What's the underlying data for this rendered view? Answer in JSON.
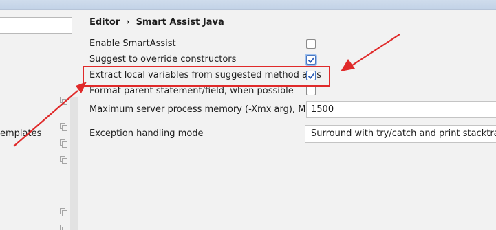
{
  "breadcrumb": {
    "parent": "Editor",
    "separator": "›",
    "current": "Smart Assist Java"
  },
  "left_panel": {
    "partial_item_label": "emplates"
  },
  "settings": {
    "enable_smartassist": {
      "label": "Enable SmartAssist",
      "checked": false
    },
    "suggest_override": {
      "label": "Suggest to override constructors",
      "checked": true
    },
    "extract_local_vars": {
      "label": "Extract local variables from suggested method args",
      "checked": true
    },
    "format_parent": {
      "label": "Format parent statement/field, when possible",
      "checked": false
    },
    "max_memory": {
      "label": "Maximum server process memory (-Xmx arg), MB",
      "value": "1500"
    },
    "exception_mode": {
      "label": "Exception handling mode",
      "selected": "Surround with try/catch and print stacktrace"
    }
  },
  "colors": {
    "annotation_red": "#e02a2a",
    "check_blue": "#2f5fb8",
    "focus_ring": "#9ec0ee"
  },
  "icons": {
    "left_panel_item_icon": "copy-icon"
  }
}
